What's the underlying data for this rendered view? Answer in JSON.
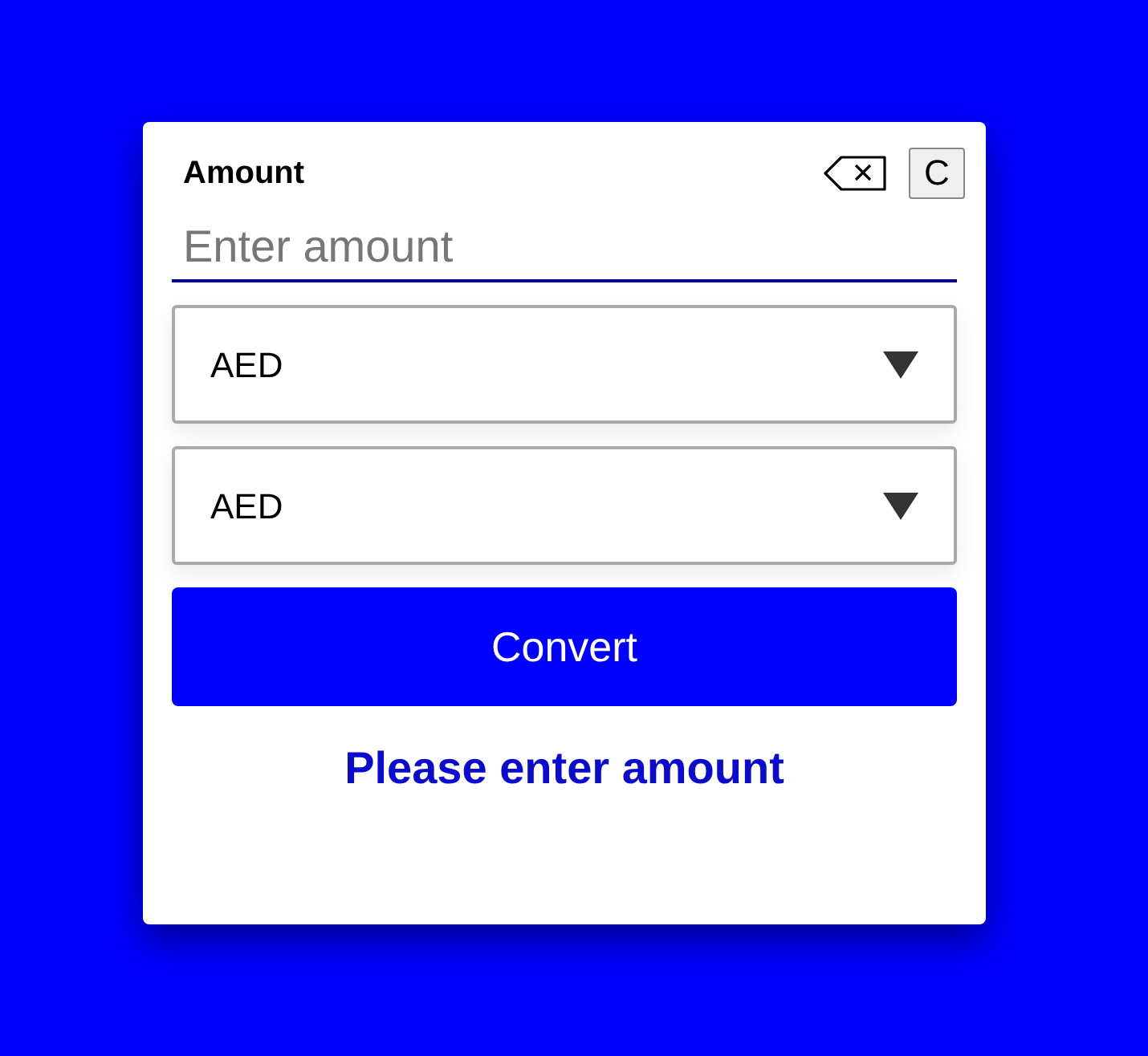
{
  "title": "Amount",
  "clear_button": "C",
  "amount_field": {
    "placeholder": "Enter amount"
  },
  "selects": [
    {
      "value": "AED"
    },
    {
      "value": "AED"
    }
  ],
  "convert_button": "Convert",
  "message": "Please enter amount"
}
